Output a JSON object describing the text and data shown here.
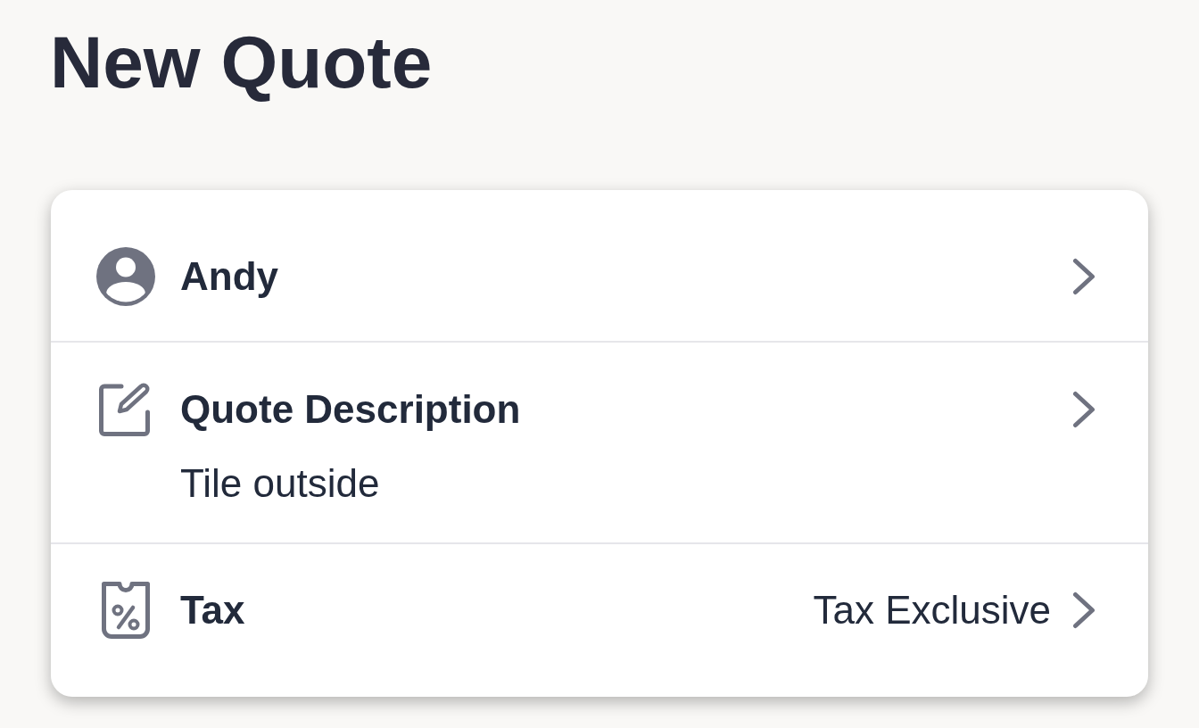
{
  "title": "New Quote",
  "rows": [
    {
      "kind": "customer",
      "label": "Andy"
    },
    {
      "kind": "description",
      "label": "Quote Description",
      "value": "Tile outside"
    },
    {
      "kind": "tax",
      "label": "Tax",
      "value": "Tax Exclusive"
    }
  ]
}
